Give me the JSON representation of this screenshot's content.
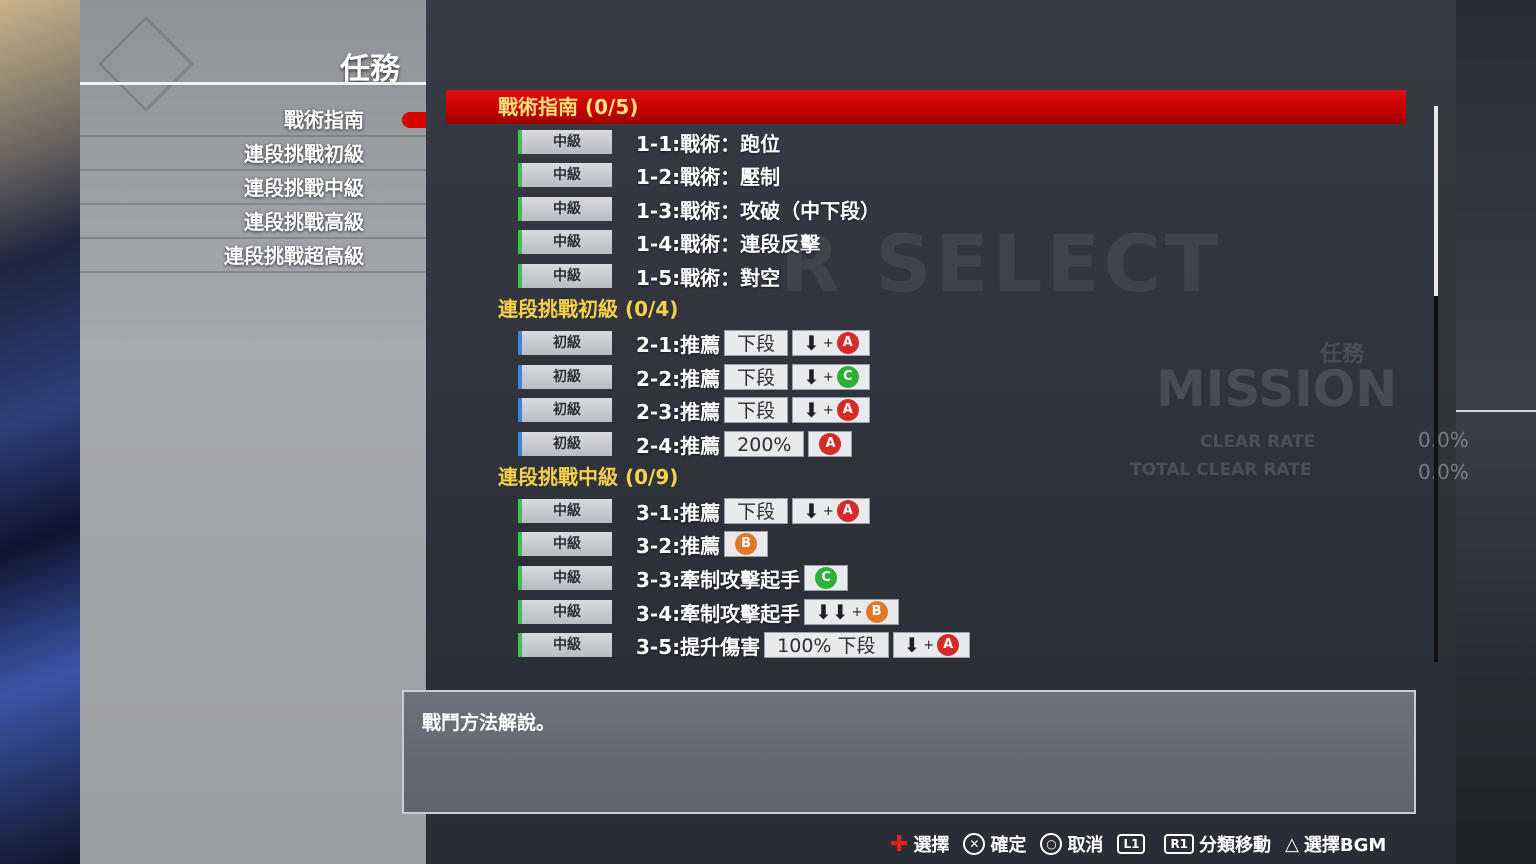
{
  "menu": {
    "title": "任務",
    "items": [
      "戰術指南",
      "連段挑戰初級",
      "連段挑戰中級",
      "連段挑戰高級",
      "連段挑戰超高級"
    ]
  },
  "watermarks": {
    "select": "R SELECT",
    "mission": "MISSION",
    "mission_jp": "任務",
    "clear_rate": "CLEAR RATE",
    "total_clear_rate": "TOTAL CLEAR RATE",
    "clear_rate_value": "0.0%",
    "total_clear_rate_value": "0.0%"
  },
  "categories": [
    {
      "title": "戰術指南 (0/5)"
    },
    {
      "title": "連段挑戰初級 (0/4)"
    },
    {
      "title": "連段挑戰中級 (0/9)"
    }
  ],
  "missions": [
    {
      "level": "中級",
      "label": "1-1:戰術：跑位"
    },
    {
      "level": "中級",
      "label": "1-2:戰術：壓制"
    },
    {
      "level": "中級",
      "label": "1-3:戰術：攻破（中下段）"
    },
    {
      "level": "中級",
      "label": "1-4:戰術：連段反擊"
    },
    {
      "level": "中級",
      "label": "1-5:戰術：對空"
    },
    {
      "level": "初級",
      "label": "2-1:推薦",
      "chip": "下段",
      "arrows": "⬇",
      "button": "A"
    },
    {
      "level": "初級",
      "label": "2-2:推薦",
      "chip": "下段",
      "arrows": "⬇",
      "button": "C"
    },
    {
      "level": "初級",
      "label": "2-3:推薦",
      "chip": "下段",
      "arrows": "⬇",
      "button": "A"
    },
    {
      "level": "初級",
      "label": "2-4:推薦",
      "chip": "200%",
      "button": "A"
    },
    {
      "level": "中級",
      "label": "3-1:推薦",
      "chip": "下段",
      "arrows": "⬇",
      "button": "A"
    },
    {
      "level": "中級",
      "label": "3-2:推薦",
      "button": "B"
    },
    {
      "level": "中級",
      "label": "3-3:牽制攻擊起手",
      "button": "C"
    },
    {
      "level": "中級",
      "label": "3-4:牽制攻擊起手",
      "arrows": "⬇⬇",
      "button": "B"
    },
    {
      "level": "中級",
      "label": "3-5:提升傷害",
      "chip": "100% 下段",
      "arrows": "⬇",
      "button": "A"
    }
  ],
  "input_plus": "+",
  "button_colors": {
    "A": "#d42a2a",
    "B": "#e0782a",
    "C": "#2fae3a"
  },
  "description": "戰鬥方法解說。",
  "footer": {
    "select_icon": "dpad-icon",
    "select_label": "選擇",
    "confirm_icon": "cross-button-icon",
    "confirm_label": "確定",
    "cancel_icon": "circle-button-icon",
    "cancel_label": "取消",
    "l1_label": "L1",
    "r1_label": "R1",
    "category_label": "分類移動",
    "bgm_icon": "triangle-button-icon",
    "bgm_label": "選擇BGM"
  }
}
